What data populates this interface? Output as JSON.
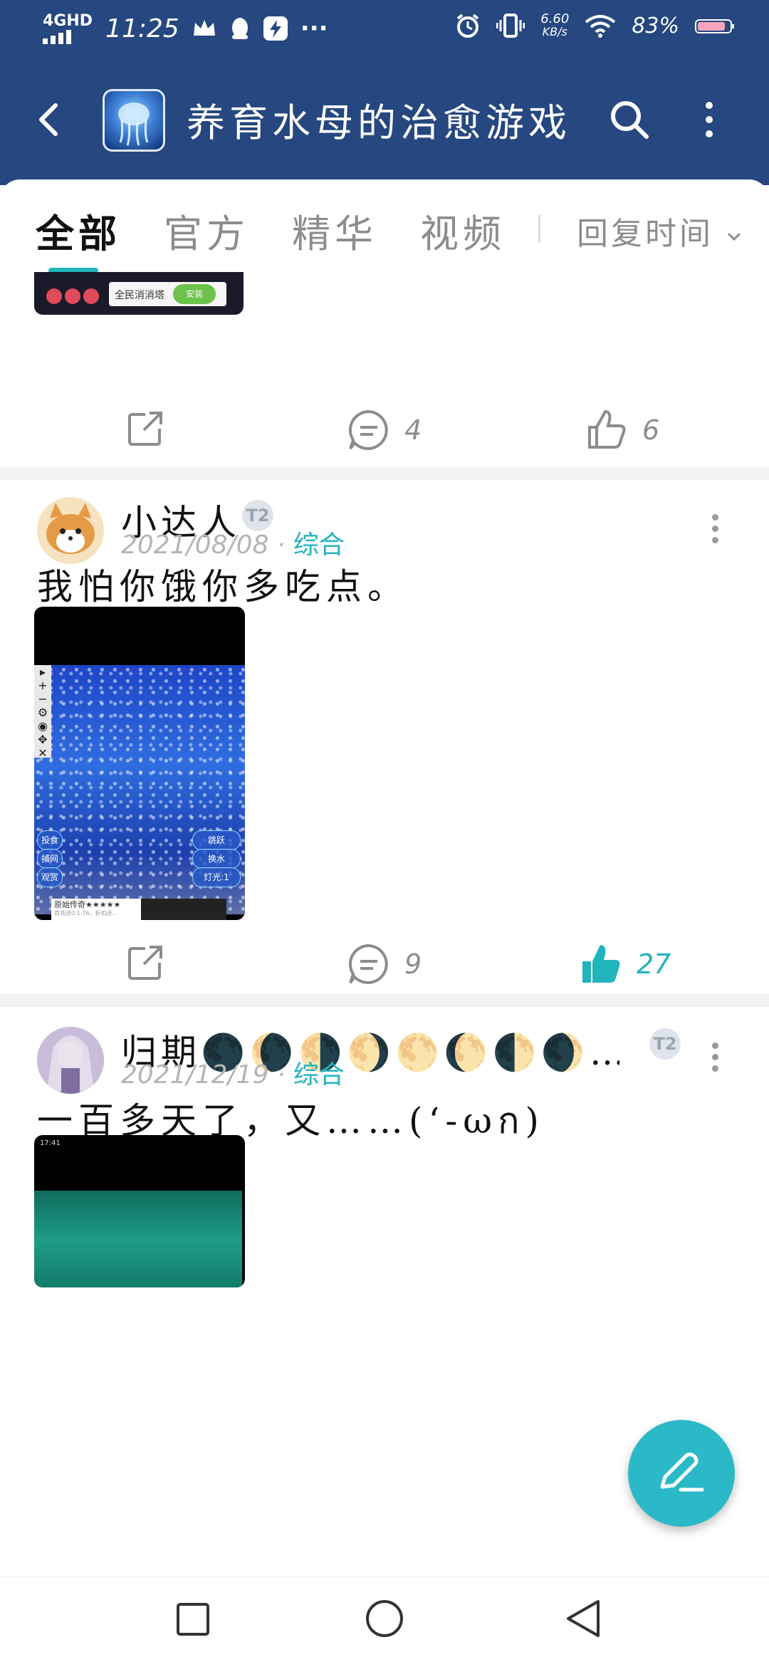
{
  "status_bar": {
    "network": "4GHD",
    "time": "11:25",
    "more": "···",
    "speed_value": "6.60",
    "speed_unit": "KB/s",
    "battery": "83%"
  },
  "app_bar": {
    "title": "养育水母的治愈游戏"
  },
  "tabs": [
    {
      "label": "全部"
    },
    {
      "label": "官方"
    },
    {
      "label": "精华"
    },
    {
      "label": "视频"
    }
  ],
  "sort": {
    "label": "回复时间"
  },
  "post_prev": {
    "ad_text": "全民消消塔",
    "ad_button": "安装",
    "comments": "4",
    "likes": "6"
  },
  "posts": [
    {
      "username": "小达人",
      "badge": "T2",
      "date": "2021/08/08",
      "category": "综合",
      "text": "我怕你饿你多吃点。",
      "shot": {
        "left_buttons": [
          "投食",
          "捕网",
          "观赏"
        ],
        "right_buttons": [
          "跳跃",
          "换水",
          "灯光:1"
        ],
        "ad_text": "原始传奇★★★★★",
        "ad_sub": "首充送0:1.76，折扣送..."
      },
      "comments": "9",
      "likes": "27",
      "liked": true
    },
    {
      "username": "归期🌑🌘🌗🌖🌕🌔🌓🌒…",
      "badge": "T2",
      "date": "2021/12/19",
      "category": "综合",
      "text": "一百多天了，又……(‘-ωก)",
      "shot": {
        "status_time": "17:41"
      }
    }
  ],
  "colors": {
    "header_bg": "#26477f",
    "accent": "#22b4bd",
    "fab": "#2cb9c7"
  },
  "icons": [
    "back-arrow-icon",
    "search-icon",
    "more-vert-icon",
    "share-icon",
    "comment-icon",
    "thumb-up-icon",
    "edit-pen-icon",
    "nav-square-icon",
    "nav-circle-icon",
    "nav-triangle-icon"
  ]
}
